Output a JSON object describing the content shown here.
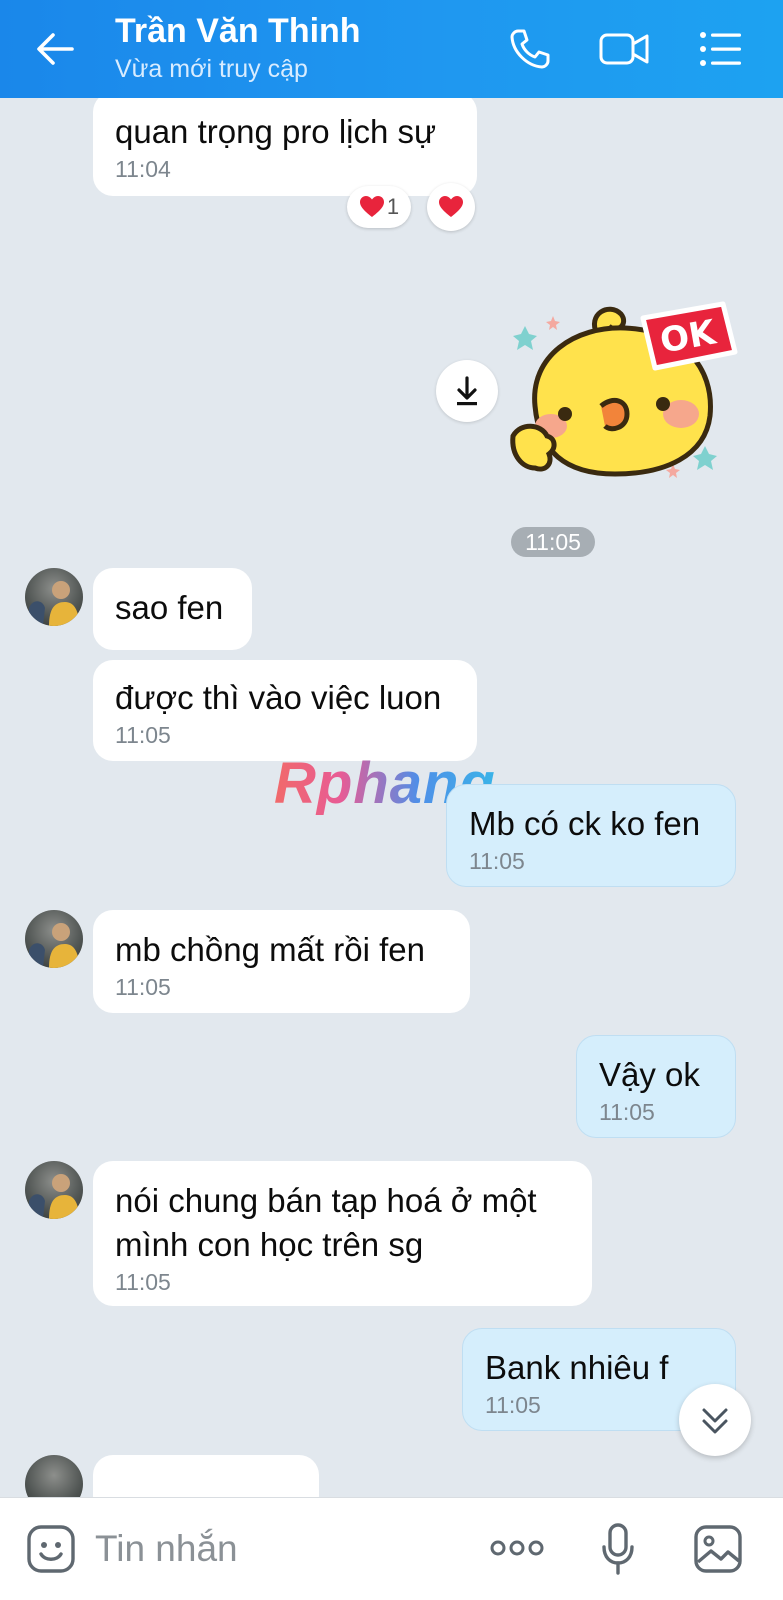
{
  "header": {
    "title": "Trần Văn Thinh",
    "subtitle": "Vừa mới truy cập"
  },
  "messages": {
    "m1": {
      "text": "quan trọng pro lịch sự",
      "time": "11:04"
    },
    "m1_reaction_count": "1",
    "sticker_time": "11:05",
    "m2": {
      "text": "sao fen"
    },
    "m3": {
      "text": "được thì vào việc luon",
      "time": "11:05"
    },
    "m4": {
      "text": "Mb có ck ko fen",
      "time": "11:05"
    },
    "m5": {
      "text": "mb chồng mất rồi fen",
      "time": "11:05"
    },
    "m6": {
      "text": "Vậy ok",
      "time": "11:05"
    },
    "m7": {
      "line1": "nói chung bán tạp hoá ở một",
      "line2": "mình con học trên sg",
      "time": "11:05"
    },
    "m8": {
      "text": "Bank nhiêu f",
      "time": "11:05"
    }
  },
  "sticker_text": "OK",
  "watermark": "Rphang",
  "input": {
    "placeholder": "Tin nhắn"
  },
  "colors": {
    "header": "#1f97f0",
    "chat_bg": "#e2e8ee",
    "incoming": "#ffffff",
    "outgoing": "#d5eefc",
    "heart": "#e8243c"
  },
  "icons": [
    "back-arrow-icon",
    "phone-icon",
    "video-call-icon",
    "menu-list-icon",
    "download-icon",
    "heart-icon",
    "chevron-double-down-icon",
    "emoji-icon",
    "more-dots-icon",
    "microphone-icon",
    "image-icon"
  ]
}
